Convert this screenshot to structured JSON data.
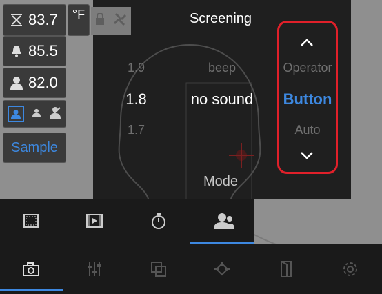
{
  "readings": {
    "max_value": "83.7",
    "alarm_value": "85.5",
    "person_value": "82.0",
    "unit": "°F"
  },
  "sample_button_label": "Sample",
  "screening_panel": {
    "title": "Screening",
    "columns": {
      "numeric": {
        "above": "1.9",
        "selected": "1.8",
        "below": "1.7"
      },
      "sound": {
        "above": "beep",
        "selected": "no sound",
        "below": ""
      },
      "mode": {
        "above": "Operator",
        "selected": "Button",
        "below": "Auto"
      }
    },
    "mode_label": "Mode"
  },
  "colors": {
    "accent_blue": "#3d88e0",
    "highlight_red": "#e0202a",
    "panel_dark": "#1e1e1e"
  },
  "toolbar_top": {
    "items": [
      {
        "icon": "frame-icon"
      },
      {
        "icon": "video-icon"
      },
      {
        "icon": "timer-icon"
      },
      {
        "icon": "screening-people-icon",
        "active": true
      }
    ]
  },
  "toolbar_bottom": {
    "items": [
      {
        "icon": "camera-icon",
        "active": true
      },
      {
        "icon": "sliders-icon"
      },
      {
        "icon": "overlay-icon"
      },
      {
        "icon": "spot-icon"
      },
      {
        "icon": "door-icon"
      },
      {
        "icon": "settings-icon"
      }
    ]
  }
}
